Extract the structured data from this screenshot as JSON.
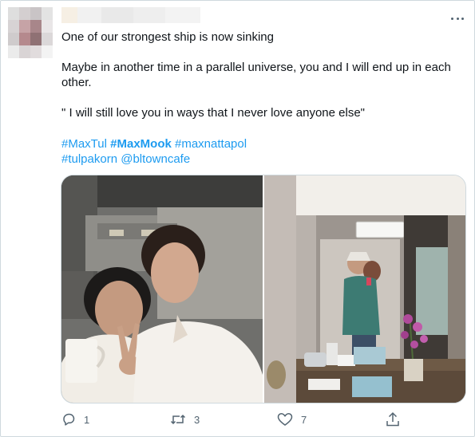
{
  "tweet": {
    "lines": [
      "One of our strongest ship is now sinking",
      "Maybe in another time in a parallel universe, you and I will end up in each",
      "other.",
      "\" I will still love you in ways that I never love anyone else\""
    ],
    "hashtags_line1": [
      "#MaxTul",
      "#MaxMook",
      "#maxnattapol"
    ],
    "hashtags_line2": [
      "#tulpakorn",
      "@bltowncafe"
    ]
  },
  "media": {
    "left_photo_icon": "selfie-photo",
    "right_photo_icon": "mirror-selfie-photo"
  },
  "actions": {
    "reply_count": "1",
    "retweet_count": "3",
    "like_count": "7"
  },
  "icons": {
    "reply": "reply-icon",
    "retweet": "retweet-icon",
    "like": "heart-icon",
    "share": "share-icon",
    "more": "more-icon"
  },
  "colors": {
    "link": "#1d9bf0",
    "text": "#0f1419",
    "secondary": "#536471",
    "border": "#cfd9de"
  }
}
